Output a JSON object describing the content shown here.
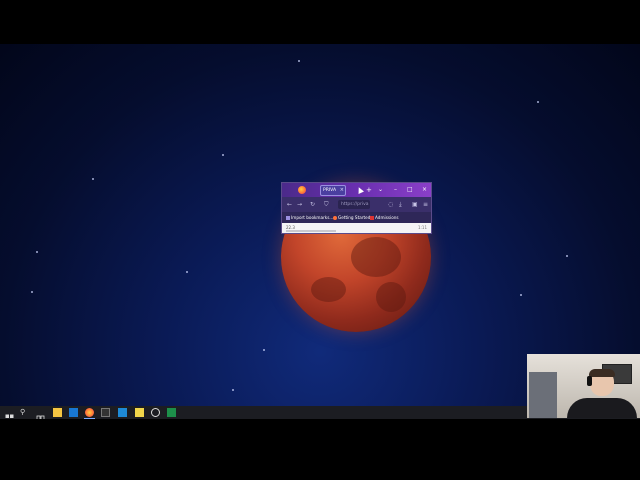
{
  "browser": {
    "tab_title": "PRIVA",
    "tab_close": "×",
    "new_tab": "+",
    "tab_list": "⌄",
    "window_minimize": "–",
    "window_maximize": "□",
    "window_close": "×",
    "nav": {
      "back": "←",
      "forward": "→",
      "reload": "↻",
      "menu": "≡"
    },
    "url_placeholder": "https://priva",
    "bookmarks": [
      {
        "label": "Import bookmarks...",
        "icon": "import-icon"
      },
      {
        "label": "Getting Started",
        "icon": "firefox-icon"
      },
      {
        "label": "Admissions",
        "icon": "bookmark-icon"
      }
    ],
    "status_left": "22.3",
    "status_right": "1:11"
  },
  "taskbar": {
    "items": [
      "windows-start-icon",
      "search-icon",
      "task-view-icon",
      "file-explorer-icon",
      "outlook-icon",
      "firefox-icon",
      "terminal-icon",
      "vscode-icon",
      "sticky-notes-icon",
      "clock-app-icon",
      "excel-icon"
    ],
    "accent": "#7aa9ff"
  },
  "colors": {
    "titlebar": "#6a2fb0",
    "moon": "#c2452a",
    "sky": "#0a1a55"
  }
}
